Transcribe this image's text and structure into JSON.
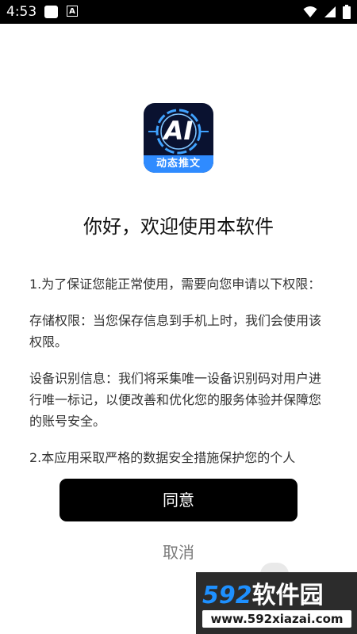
{
  "status_bar": {
    "time": "4:53",
    "notification_letter": "A",
    "icons": [
      "wifi-icon",
      "signal-icon",
      "battery-icon"
    ]
  },
  "app_logo": {
    "mark": "AI",
    "caption": "动态推文"
  },
  "welcome_title": "你好，欢迎使用本软件",
  "permissions": {
    "paragraphs": [
      "1.为了保证您能正常使用，需要向您申请以下权限：",
      "存储权限：当您保存信息到手机上时，我们会使用该权限。",
      "设备识别信息：我们将采集唯一设备识别码对用户进行唯一标记，以便改善和优化您的服务体验并保障您的账号安全。",
      "2.本应用采取严格的数据安全措施保护您的个人"
    ]
  },
  "buttons": {
    "agree": "同意",
    "cancel": "取消"
  },
  "watermark": {
    "brand_number": "592",
    "brand_text": "软件园",
    "url": "www.592xiazai.com"
  },
  "colors": {
    "primary_button": "#000000",
    "accent_blue": "#2f8bff",
    "status_bar": "#000000"
  }
}
